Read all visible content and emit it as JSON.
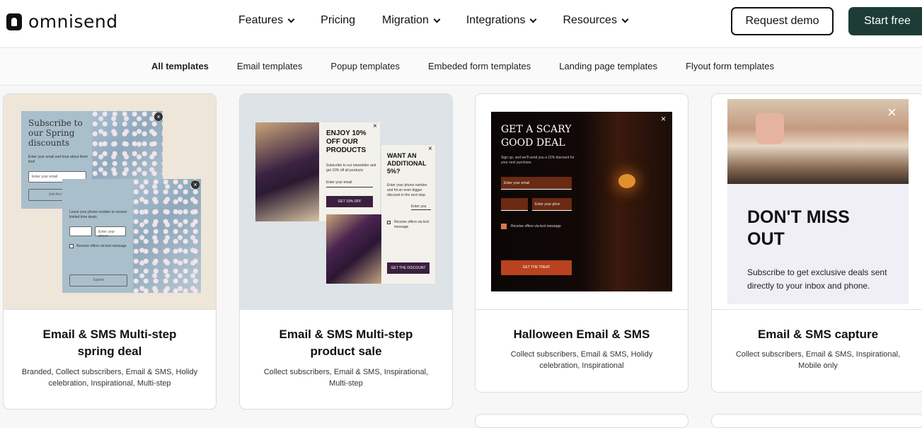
{
  "header": {
    "logo_text": "omnisend",
    "nav": [
      {
        "label": "Features",
        "dropdown": true
      },
      {
        "label": "Pricing",
        "dropdown": false
      },
      {
        "label": "Migration",
        "dropdown": true
      },
      {
        "label": "Integrations",
        "dropdown": true
      },
      {
        "label": "Resources",
        "dropdown": true
      }
    ],
    "request_demo": "Request demo",
    "start_free": "Start free"
  },
  "subnav": {
    "items": [
      "All templates",
      "Email templates",
      "Popup templates",
      "Embeded form templates",
      "Landing page templates",
      "Flyout form templates"
    ],
    "active": "All templates"
  },
  "cards": [
    {
      "title": "Email & SMS Multi-step spring deal",
      "tags": "Branded, Collect subscribers, Email & SMS, Holidy celebration, Inspirational, Multi-step",
      "preview": {
        "heading": "Subscribe to our Spring discounts",
        "text": "Enter your email and hear about them first!",
        "email_placeholder": "Enter your email",
        "button": "Join the list",
        "phone_text": "Leave your phone number to receive limited time deals.",
        "phone_placeholder": "Enter your phone",
        "checkbox": "Receive offers via text message",
        "submit": "Submit"
      }
    },
    {
      "title": "Email & SMS Multi-step product sale",
      "tags": "Collect subscribers, Email & SMS, Inspirational, Multi-step",
      "preview": {
        "heading1": "ENJOY 10% OFF OUR PRODUCTS",
        "text1": "Subscribe to our newsletter and get 10% off all products",
        "email_placeholder": "Enter your email",
        "button1": "GET 10% OFF",
        "heading2": "WANT AN ADDITIONAL 5%?",
        "text2": "Enter your phone number and hit an even bigger discount in the next step",
        "phone_placeholder": "Enter you",
        "checkbox": "Receive offers via text message",
        "button2": "GET THE DISCOUNT"
      }
    },
    {
      "title": "Halloween Email & SMS",
      "tags": "Collect subscribers, Email & SMS, Holidy celebration, Inspirational",
      "preview": {
        "heading": "GET A SCARY GOOD DEAL",
        "text": "Sign up, and we'll send you a 15% discount for your next purchase.",
        "email_placeholder": "Enter your email",
        "phone_placeholder": "Enter your phon",
        "checkbox": "Receive offers via text message",
        "button": "GET THE TREAT"
      }
    },
    {
      "title": "Email & SMS capture",
      "tags": "Collect subscribers, Email & SMS, Inspirational, Mobile only",
      "preview": {
        "heading": "DON'T MISS OUT",
        "text": "Subscribe to get exclusive deals sent directly to your inbox and phone."
      }
    }
  ],
  "colors": {
    "brand_dark": "#1d3c36",
    "halloween_bg": "#0b0605",
    "halloween_accent": "#b8431e"
  }
}
